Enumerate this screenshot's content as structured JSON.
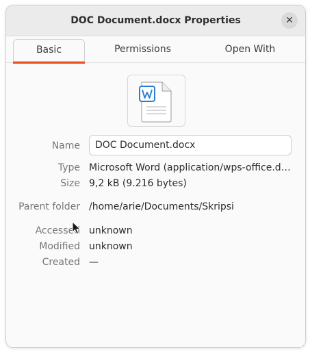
{
  "window": {
    "title": "DOC Document.docx Properties",
    "close_label": "✕"
  },
  "tabs": [
    {
      "label": "Basic",
      "active": true
    },
    {
      "label": "Permissions",
      "active": false
    },
    {
      "label": "Open With",
      "active": false
    }
  ],
  "file_icon": {
    "name": "word-document-icon",
    "glyph": "W"
  },
  "properties": {
    "name_label": "Name",
    "name_value": "DOC Document.docx",
    "type_label": "Type",
    "type_value": "Microsoft Word (application/wps-office.d…",
    "size_label": "Size",
    "size_value": "9,2 kB (9.216 bytes)",
    "parent_label": "Parent folder",
    "parent_value": "/home/arie/Documents/Skripsi",
    "accessed_label": "Accessed",
    "accessed_value": "unknown",
    "modified_label": "Modified",
    "modified_value": "unknown",
    "created_label": "Created",
    "created_value": "—"
  },
  "colors": {
    "accent": "#e95420",
    "word_blue": "#2a7fd4"
  }
}
